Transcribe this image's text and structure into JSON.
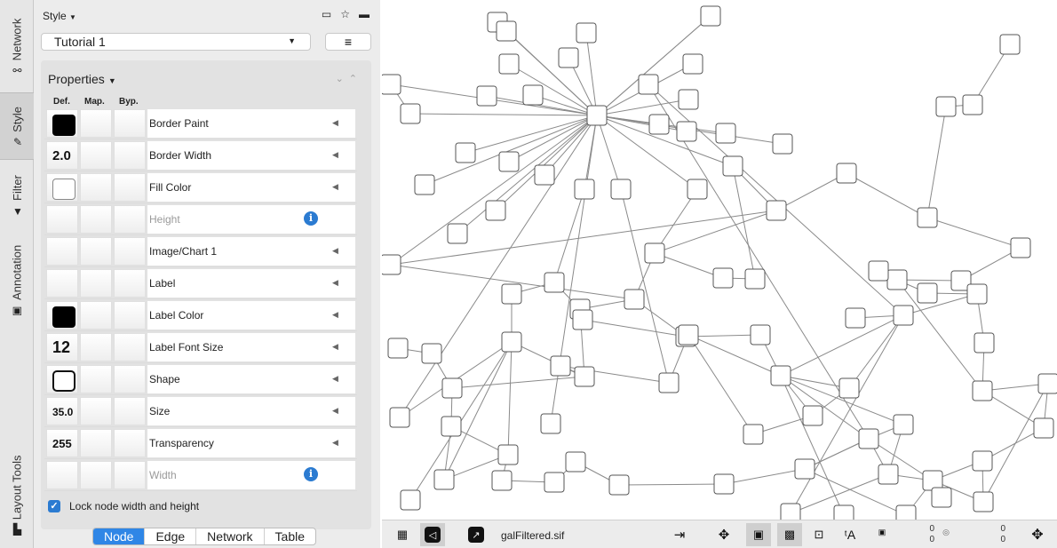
{
  "vertical_tabs": [
    {
      "label": "Network",
      "icon": "network-icon"
    },
    {
      "label": "Style",
      "icon": "brush-icon"
    },
    {
      "label": "Filter",
      "icon": "filter-icon"
    },
    {
      "label": "Annotation",
      "icon": "annotation-icon"
    },
    {
      "label": "Layout Tools",
      "icon": "ruler-icon"
    }
  ],
  "panel": {
    "title": "Style",
    "style_name": "Tutorial 1",
    "menu_icon": "hamburger-icon",
    "properties_title": "Properties",
    "columns": [
      "Def.",
      "Map.",
      "Byp."
    ]
  },
  "properties": [
    {
      "name": "Border Paint",
      "def": ""
    },
    {
      "name": "Border Width",
      "def": "2.0"
    },
    {
      "name": "Fill Color",
      "def": ""
    },
    {
      "name": "Height",
      "def": ""
    },
    {
      "name": "Image/Chart 1",
      "def": ""
    },
    {
      "name": "Label",
      "def": ""
    },
    {
      "name": "Label Color",
      "def": ""
    },
    {
      "name": "Label Font Size",
      "def": "12"
    },
    {
      "name": "Shape",
      "def": ""
    },
    {
      "name": "Size",
      "def": "35.0"
    },
    {
      "name": "Transparency",
      "def": "255"
    },
    {
      "name": "Width",
      "def": ""
    }
  ],
  "lock_label": "Lock node width and height",
  "bottom_tabs": [
    "Node",
    "Edge",
    "Network",
    "Table"
  ],
  "toolbar": {
    "filename": "galFiltered.sif",
    "selected_nodes": "0",
    "hidden_nodes": "0",
    "selected_edges": "0",
    "hidden_edges": "0"
  },
  "colors": {
    "accent": "#2f86e6",
    "info": "#2b7bd1",
    "edge": "#8a8a8a",
    "node_border": "#555555"
  }
}
